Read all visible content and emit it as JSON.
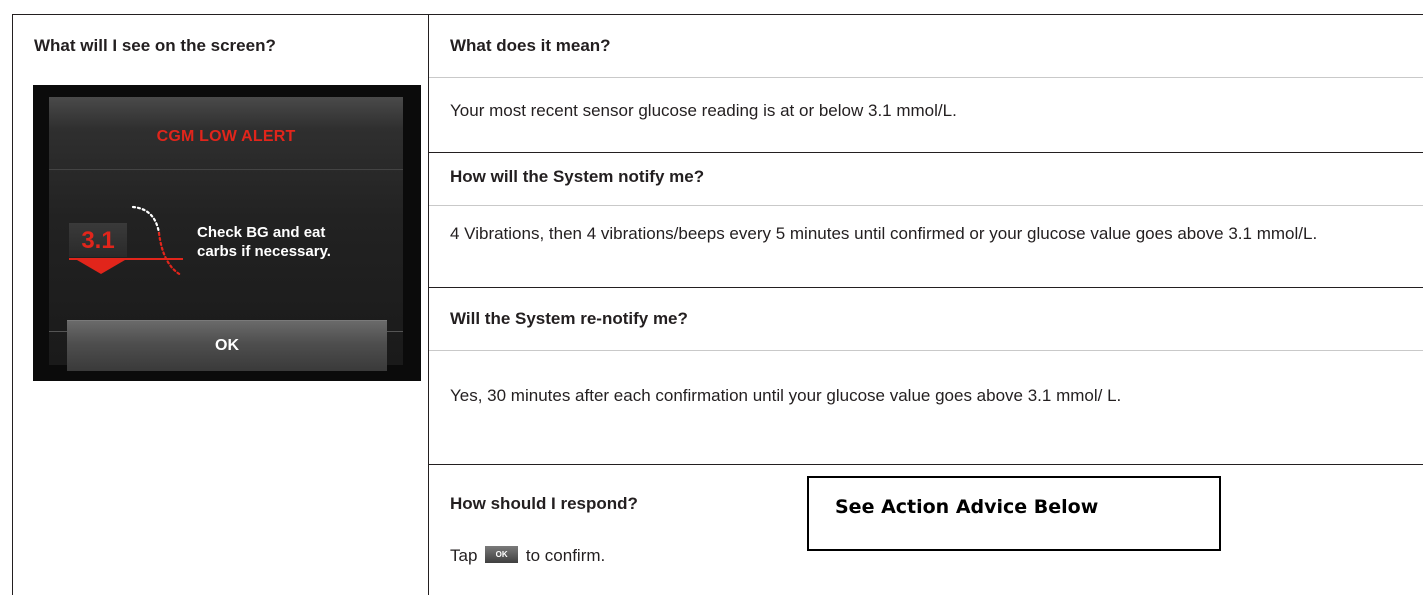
{
  "left": {
    "heading": "What will I see on the screen?",
    "device": {
      "alert_title": "CGM LOW ALERT",
      "glucose_value": "3.1",
      "message_line1": "Check BG and eat",
      "message_line2": "carbs if necessary.",
      "ok_label": "OK",
      "alert_color": "#e1251b",
      "trend_icon": "downward-dotted-trend-icon"
    }
  },
  "rows": [
    {
      "label": "What does it mean?",
      "body": "Your most recent sensor glucose reading is at or below 3.1 mmol/L."
    },
    {
      "label": "How will the System notify me?",
      "body": "4 Vibrations, then 4 vibrations/beeps every 5 minutes until confirmed or your glucose value goes above 3.1 mmol/L."
    },
    {
      "label": "Will the System re-notify me?",
      "body": "Yes, 30 minutes after each confirmation until your glucose value goes above 3.1 mmol/ L."
    },
    {
      "label": "How should I respond?",
      "body_prefix": "Tap",
      "ok_chip": "OK",
      "body_suffix": "to confirm."
    }
  ],
  "action_box": {
    "text": "See Action Advice Below"
  }
}
